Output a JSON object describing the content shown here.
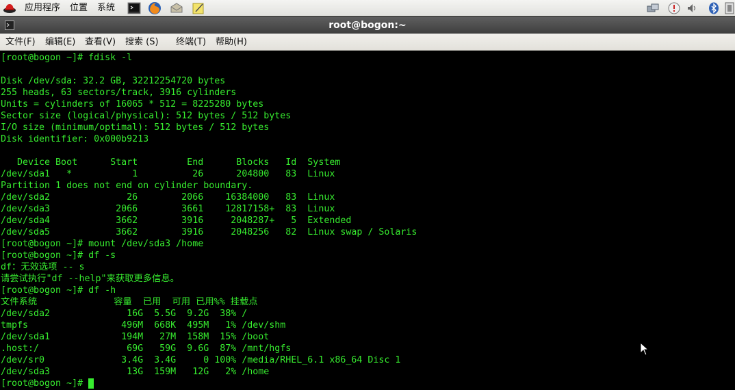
{
  "panel": {
    "menus": [
      "应用程序",
      "位置",
      "系统"
    ],
    "launchers": [
      "terminal-icon",
      "firefox-icon",
      "mail-icon",
      "notes-icon"
    ],
    "tray": [
      "network-icon",
      "update-icon",
      "volume-icon",
      "bluetooth-icon",
      "power-icon"
    ]
  },
  "window": {
    "title": "root@bogon:~"
  },
  "menubar": {
    "items": [
      "文件(F)",
      "编辑(E)",
      "查看(V)",
      "搜索 (S)",
      "终端(T)",
      "帮助(H)"
    ]
  },
  "terminal": {
    "lines": [
      "[root@bogon ~]# fdisk -l",
      "",
      "Disk /dev/sda: 32.2 GB, 32212254720 bytes",
      "255 heads, 63 sectors/track, 3916 cylinders",
      "Units = cylinders of 16065 * 512 = 8225280 bytes",
      "Sector size (logical/physical): 512 bytes / 512 bytes",
      "I/O size (minimum/optimal): 512 bytes / 512 bytes",
      "Disk identifier: 0x000b9213",
      "",
      "   Device Boot      Start         End      Blocks   Id  System",
      "/dev/sda1   *           1          26      204800   83  Linux",
      "Partition 1 does not end on cylinder boundary.",
      "/dev/sda2              26        2066    16384000   83  Linux",
      "/dev/sda3            2066        3661    12817158+  83  Linux",
      "/dev/sda4            3662        3916     2048287+   5  Extended",
      "/dev/sda5            3662        3916     2048256   82  Linux swap / Solaris",
      "[root@bogon ~]# mount /dev/sda3 /home",
      "[root@bogon ~]# df -s",
      "df：无效选项 -- s",
      "请尝试执行\"df --help\"来获取更多信息。",
      "[root@bogon ~]# df -h",
      "文件系统              容量  已用  可用 已用%% 挂载点",
      "/dev/sda2              16G  5.5G  9.2G  38% /",
      "tmpfs                 496M  668K  495M   1% /dev/shm",
      "/dev/sda1             194M   27M  158M  15% /boot",
      ".host:/                69G   59G  9.6G  87% /mnt/hgfs",
      "/dev/sr0              3.4G  3.4G     0 100% /media/RHEL_6.1 x86_64 Disc 1",
      "/dev/sda3              13G  159M   12G   2% /home",
      "[root@bogon ~]# "
    ]
  },
  "colors": {
    "terminal_fg": "#37ec2f",
    "terminal_bg": "#000000",
    "titlebar_bg": "#4b4b4b"
  }
}
